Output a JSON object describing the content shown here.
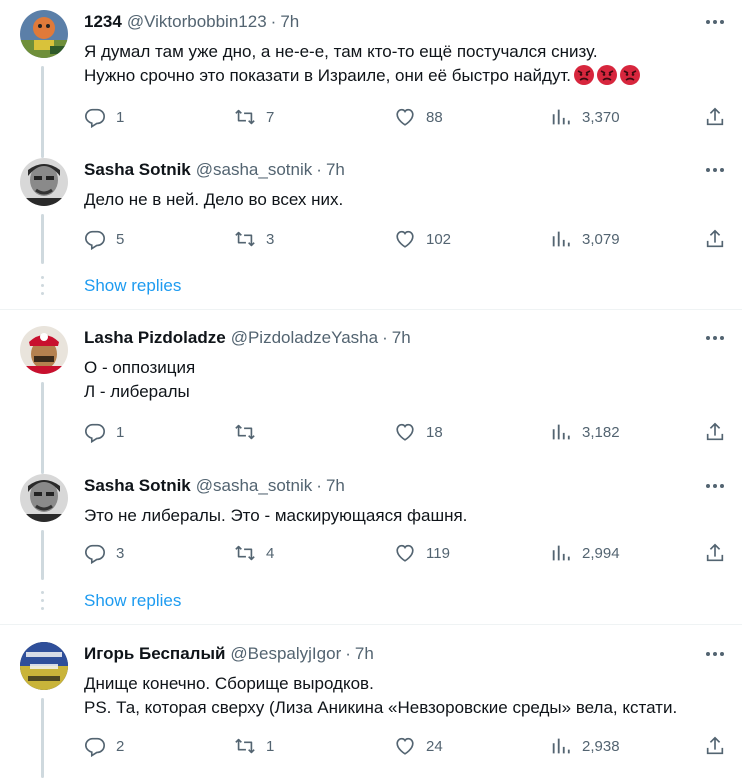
{
  "tweets": [
    {
      "name": "1234",
      "handle": "@Viktorbobbin123",
      "sep": "·",
      "time": "7h",
      "lines": [
        "Я думал там уже дно, а не-е-е, там кто-то ещё постучался снизу.",
        "Нужно срочно это показати в Израиле, они её быстро найдут."
      ],
      "emoji": "angry-face-emoji",
      "emoji_count": 3,
      "replies": "1",
      "retweets": "7",
      "likes": "88",
      "views": "3,370"
    },
    {
      "name": "Sasha Sotnik",
      "handle": "@sasha_sotnik",
      "sep": "·",
      "time": "7h",
      "lines": [
        "Дело не в ней. Дело во всех них."
      ],
      "replies": "5",
      "retweets": "3",
      "likes": "102",
      "views": "3,079"
    },
    {
      "name": "Lasha Pizdoladze",
      "handle": "@PizdoladzeYasha",
      "sep": "·",
      "time": "7h",
      "lines": [
        "О - оппозиция",
        "Л - либералы"
      ],
      "replies": "1",
      "retweets": "",
      "likes": "18",
      "views": "3,182"
    },
    {
      "name": "Sasha Sotnik",
      "handle": "@sasha_sotnik",
      "sep": "·",
      "time": "7h",
      "lines": [
        "Это не либералы. Это - маскирующаяся фашня."
      ],
      "replies": "3",
      "retweets": "4",
      "likes": "119",
      "views": "2,994"
    },
    {
      "name": "Игорь Беспалый",
      "handle": "@BespalyjIgor",
      "sep": "·",
      "time": "7h",
      "lines": [
        "Днище конечно. Сборище выродков.",
        "PS. Та, которая сверху (Лиза Аникина «Невзоровские среды» вела, кстати."
      ],
      "replies": "2",
      "retweets": "1",
      "likes": "24",
      "views": "2,938"
    }
  ],
  "show_replies_label": "Show replies",
  "colors": {
    "text": "#0f1419",
    "muted": "#536471",
    "link": "#1d9bf0",
    "thread_line": "#cfd9de",
    "divider": "#eff3f4"
  },
  "icons": [
    "reply-icon",
    "retweet-icon",
    "like-icon",
    "views-icon",
    "share-icon",
    "more-icon"
  ]
}
